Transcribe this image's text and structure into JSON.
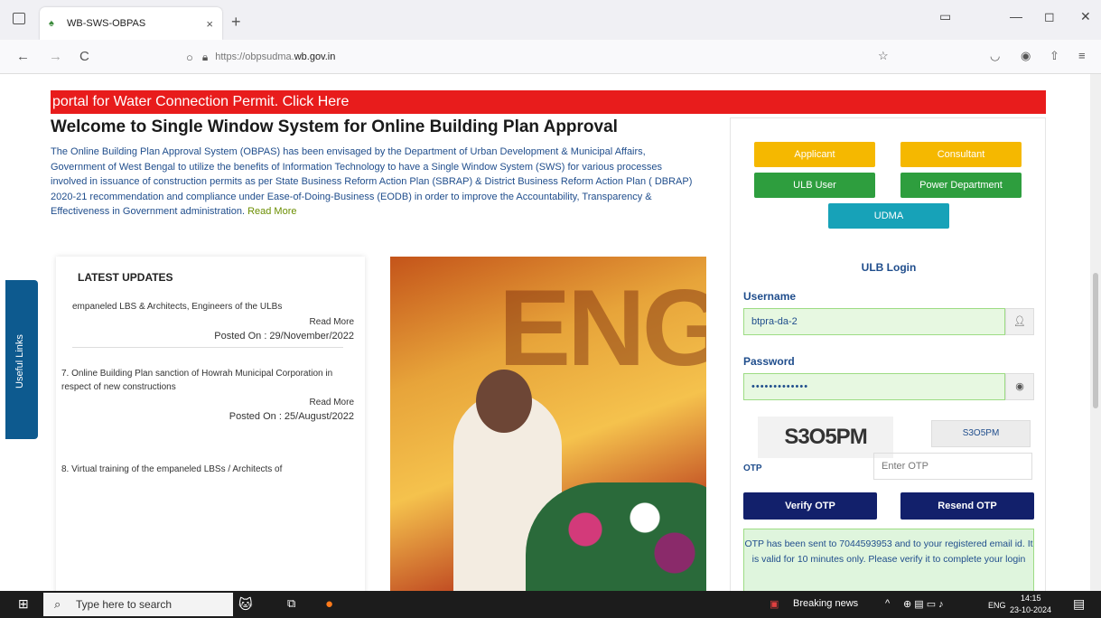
{
  "browser": {
    "tab_title": "WB-SWS-OBPAS",
    "tab_close": "×",
    "new_tab": "+",
    "url_prefix": "https://obpsudma.",
    "url_domain": "wb.gov.in",
    "back": "←",
    "forward": "→",
    "reload": "C",
    "minimize": "—",
    "maximize": "◻",
    "close": "✕"
  },
  "page": {
    "marquee": "portal for Water Connection Permit. Click Here",
    "welcome_title": "Welcome to Single Window System for Online Building Plan Approval",
    "intro_text": "The Online Building Plan Approval System (OBPAS) has been envisaged by the Department of Urban Development & Municipal Affairs, Government of West Bengal to utilize the benefits of Information Technology to have a Single Window System (SWS) for various processes involved in issuance of construction permits as per State Business Reform Action Plan (SBRAP) & District Business Reform Action Plan ( DBRAP) 2020-21 recommendation and compliance under Ease-of-Doing-Business (EODB) in order to improve the Accountability, Transparency & Effectiveness in Government administration.",
    "intro_read_more": "Read More",
    "useful_links": "Useful Links",
    "updates_title": "LATEST UPDATES",
    "updates": [
      {
        "text": "empaneled LBS & Architects, Engineers of the ULBs",
        "read_more": "Read More",
        "posted": "Posted On : 29/November/2022"
      },
      {
        "text": "7. Online Building Plan sanction of Howrah Municipal Corporation in respect of new constructions",
        "read_more": "Read More",
        "posted": "Posted On : 25/August/2022"
      },
      {
        "text": "8. Virtual training of the empaneled LBSs / Architects of",
        "read_more": "",
        "posted": ""
      }
    ]
  },
  "login": {
    "roles": {
      "applicant": "Applicant",
      "consultant": "Consultant",
      "ulb_user": "ULB User",
      "power_department": "Power Department",
      "udma": "UDMA"
    },
    "title": "ULB Login",
    "username_label": "Username",
    "username_value": "btpra-da-2",
    "password_label": "Password",
    "password_value": "•••••••••••••",
    "captcha_text": "S3O5PM",
    "captcha_input": "S3O5PM",
    "otp_label": "OTP",
    "otp_placeholder": "Enter OTP",
    "verify_button": "Verify OTP",
    "resend_button": "Resend OTP",
    "message": "OTP has been sent to 7044593953 and to your registered email id. It is valid for 10 minutes only. Please verify it to complete your login"
  },
  "taskbar": {
    "search_placeholder": "Type here to search",
    "news": "Breaking news",
    "lang": "ENG",
    "time": "14:15",
    "date": "23-10-2024"
  },
  "colors": {
    "marquee_red": "#e81c1c",
    "applicant_yellow": "#f5b800",
    "ulb_green": "#2e9e3e",
    "udma_teal": "#17a2b8",
    "navy": "#12206b"
  }
}
